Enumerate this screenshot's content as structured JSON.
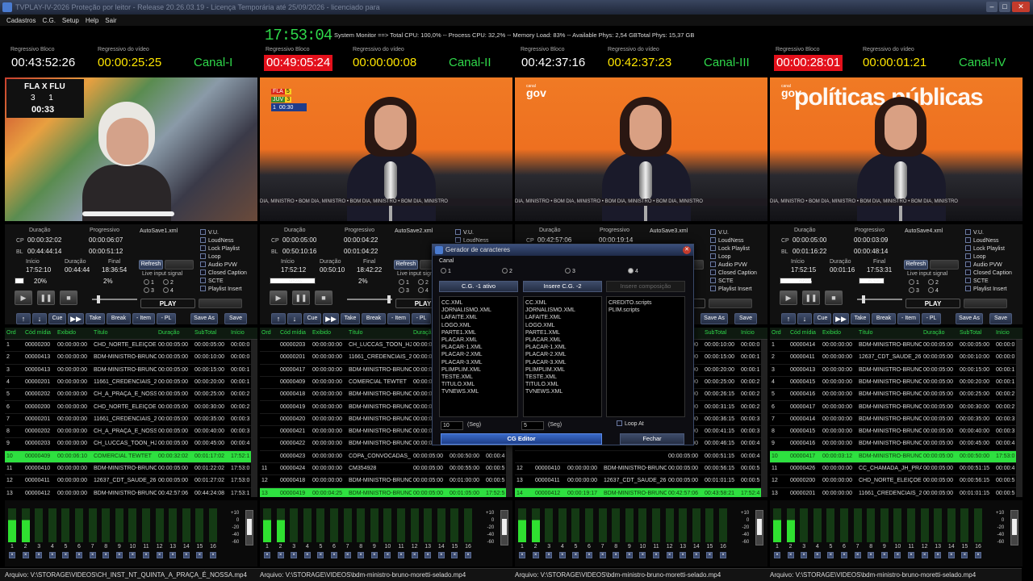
{
  "window": {
    "title": "TVPLAY-IV-2026 Proteção por leitor - Release 20.26.03.19 - Licença Temporária até 25/09/2026 - licenciado para"
  },
  "menu": [
    "Cadastros",
    "C.G.",
    "Setup",
    "Help",
    "Sair"
  ],
  "system": {
    "clock": "17:53:04",
    "monitor": "System Monitor ==> Total CPU: 100,0% -- Process CPU: 32,2% -- Memory Load: 83% -- Available Phys: 2,54 GBTotal  Phys: 15,37 GB"
  },
  "labels": {
    "regressivo_bloco": "Regressivo Bloco",
    "regressivo_video": "Regressivo do vídeo",
    "duracao": "Duração",
    "progressivo": "Progressivo",
    "cp": "CP",
    "bl": "BL",
    "inicio": "Início",
    "final": "Final",
    "refresh": "Refresh",
    "live_input": "Live input signal",
    "play": "PLAY",
    "grid_headers": [
      "Ord",
      "Cód mídia",
      "Exibido",
      "Título",
      "Duração",
      "SubTotal",
      "Início"
    ],
    "row_buttons": [
      "Cue",
      "Take",
      "Break",
      "- Item",
      "- PL",
      "Save As",
      "Save"
    ],
    "options": [
      "V.U.",
      "LoudNess",
      "Lock Playlist",
      "Loop",
      "Audio PVW",
      "Closed Caption",
      "SCTE",
      "Playlist Insert"
    ],
    "radio": [
      "1",
      "2",
      "3",
      "4"
    ],
    "db_scale": "+10\n  0\n-20\n-40\n-60",
    "meter_nums": [
      "1",
      "2",
      "3",
      "4",
      "5",
      "6",
      "7",
      "8",
      "9",
      "10",
      "11",
      "12",
      "13",
      "14",
      "15",
      "16"
    ]
  },
  "overlay": {
    "score_a": {
      "teams": "FLA X FLU",
      "score": "3      1",
      "time": "00:33"
    },
    "score_b": {
      "t1": "FLA",
      "t2": "JUV",
      "s1": "5",
      "s2": "3",
      "period": "1",
      "time": "00:30"
    },
    "gov": {
      "small": "canal",
      "big": "gov"
    },
    "politicas": "políticas públicas",
    "ticker": "DIA, MINISTRO • BOM DIA, MINISTRO • BOM DIA, MINISTRO • BOM DIA, MINISTRO"
  },
  "channels": [
    {
      "name": "Canal-I",
      "bloco": "00:43:52:26",
      "bloco_red": false,
      "video": "00:00:25:25",
      "cp_dur": "00:00:32:02",
      "cp_prog": "00:00:06:07",
      "bl_dur": "00:44:44:14",
      "bl_prog": "00:00:51:12",
      "autosave": "AutoSave1.xml",
      "inicio": "17:52:10",
      "duracao": "00:44:44",
      "final": "18:36:54",
      "pct1": "20%",
      "pct2": "2%",
      "progress1": 0.2,
      "progress2": 0.02,
      "rows": [
        [
          "1",
          "00000200",
          "00:00:00:00",
          "CHD_NORTE_ELEIÇÕES_",
          "00:00:05:00",
          "00:00:05:00",
          "00:00:0"
        ],
        [
          "2",
          "00000413",
          "00:00:00:00",
          "BDM-MINISTRO-BRUNO-I",
          "00:00:05:00",
          "00:00:10:00",
          "00:00:0"
        ],
        [
          "3",
          "00000413",
          "00:00:00:00",
          "BDM-MINISTRO-BRUNO-I",
          "00:00:05:00",
          "00:00:15:00",
          "00:00:1"
        ],
        [
          "4",
          "00000201",
          "00:00:00:00",
          "11661_CREDENCIAIS_26",
          "00:00:05:00",
          "00:00:20:00",
          "00:00:1"
        ],
        [
          "5",
          "00000202",
          "00:00:00:00",
          "CH_A_PRAÇA_É_NOSS",
          "00:00:05:00",
          "00:00:25:00",
          "00:00:2"
        ],
        [
          "6",
          "00000200",
          "00:00:00:00",
          "CHD_NORTE_ELEIÇÕES_",
          "00:00:05:00",
          "00:00:30:00",
          "00:00:2"
        ],
        [
          "7",
          "00000201",
          "00:00:00:00",
          "11661_CREDENCIAIS_26",
          "00:00:05:00",
          "00:00:35:00",
          "00:00:3"
        ],
        [
          "8",
          "00000202",
          "00:00:00:00",
          "CH_A_PRAÇA_É_NOSS",
          "00:00:05:00",
          "00:00:40:00",
          "00:00:3"
        ],
        [
          "9",
          "00000203",
          "00:00:00:00",
          "CH_LUCCAS_TOON_HJ_",
          "00:00:05:00",
          "00:00:45:00",
          "00:00:4"
        ],
        [
          "10",
          "00000409",
          "00:00:06:10",
          "COMERCIAL TEWTET",
          "00:00:32:02",
          "00:01:17:02",
          "17:52:1"
        ],
        [
          "11",
          "00000410",
          "00:00:00:00",
          "BDM-MINISTRO-BRUNO-I",
          "00:00:05:00",
          "00:01:22:02",
          "17:53:0"
        ],
        [
          "12",
          "00000411",
          "00:00:00:00",
          "12637_CDT_SAUDE_26",
          "00:00:05:00",
          "00:01:27:02",
          "17:53:0"
        ],
        [
          "13",
          "00000412",
          "00:00:00:00",
          "BDM-MINISTRO-BRUNO-I",
          "00:42:57:06",
          "00:44:24:08",
          "17:53:1"
        ]
      ],
      "hl_row": 9,
      "meter_on": [
        true,
        true
      ],
      "file": "Arquivo: V:\\STORAGE\\VIDEOS\\CH_INST_NT_QUINTA_A_PRAÇA_É_NOSSA.mp4"
    },
    {
      "name": "Canal-II",
      "bloco": "00:49:05:24",
      "bloco_red": true,
      "video": "00:00:00:08",
      "cp_dur": "00:00:05:00",
      "cp_prog": "00:00:04:22",
      "bl_dur": "00:50:10:16",
      "bl_prog": "00:01:04:22",
      "autosave": "AutoSave2.xml",
      "inicio": "17:52:12",
      "duracao": "00:50:10",
      "final": "18:42:22",
      "pct1": "95%",
      "pct2": "2%",
      "progress1": 0.95,
      "progress2": 0.02,
      "rows": [
        [
          "",
          "00000203",
          "00:00:00:00",
          "CH_LUCCAS_TOON_HJ_",
          "00:00:05:00",
          "00:00:05:00",
          "00:00:0"
        ],
        [
          "",
          "00000201",
          "00:00:00:00",
          "11661_CREDENCIAIS_26",
          "00:00:05:00",
          "00:00:10:00",
          "00:00:0"
        ],
        [
          "",
          "00000417",
          "00:00:00:00",
          "BDM-MINISTRO-BRUNO-I",
          "00:00:05:00",
          "00:00:15:00",
          "00:00:1"
        ],
        [
          "",
          "00000409",
          "00:00:00:00",
          "COMERCIAL TEWTET",
          "00:00:05:00",
          "00:00:20:00",
          "00:00:1"
        ],
        [
          "",
          "00000418",
          "00:00:00:00",
          "BDM-MINISTRO-BRUNO-I",
          "00:00:05:00",
          "00:00:25:00",
          "00:00:2"
        ],
        [
          "",
          "00000419",
          "00:00:00:00",
          "BDM-MINISTRO-BRUNO-I",
          "00:00:05:00",
          "00:00:30:00",
          "00:00:2"
        ],
        [
          "",
          "00000420",
          "00:00:00:00",
          "BDM-MINISTRO-BRUNO-I",
          "00:00:05:00",
          "00:00:35:00",
          "00:00:3"
        ],
        [
          "",
          "00000421",
          "00:00:00:00",
          "BDM-MINISTRO-BRUNO-I",
          "00:00:05:00",
          "00:00:40:00",
          "00:00:3"
        ],
        [
          "",
          "00000422",
          "00:00:00:00",
          "BDM-MINISTRO-BRUNO-I",
          "00:00:05:00",
          "00:00:45:00",
          "00:00:4"
        ],
        [
          "",
          "00000423",
          "00:00:00:00",
          "COPA_CONVOCADAS_",
          "00:00:05:00",
          "00:00:50:00",
          "00:00:4"
        ],
        [
          "11",
          "00000424",
          "00:00:00:00",
          "CM354928",
          "00:00:05:00",
          "00:00:55:00",
          "00:00:5"
        ],
        [
          "12",
          "00000418",
          "00:00:00:00",
          "BDM-MINISTRO-BRUNO-I",
          "00:00:05:00",
          "00:01:00:00",
          "00:00:5"
        ],
        [
          "13",
          "00000419",
          "00:00:04:25",
          "BDM-MINISTRO-BRUNO-I",
          "00:00:05:00",
          "00:01:05:00",
          "17:52:5"
        ],
        [
          "14",
          "00000420",
          "00:00:00:00",
          "BDM-MINISTRO-BRUNO-I",
          "00:00:05:00",
          "00:01:10:00",
          "17:53:0"
        ]
      ],
      "hl_row": 12,
      "meter_on": [
        true,
        true
      ],
      "file": "Arquivo: V:\\STORAGE\\VIDEOS\\bdm-ministro-bruno-moretti-selado.mp4"
    },
    {
      "name": "Canal-III",
      "bloco": "00:42:37:16",
      "bloco_red": false,
      "video": "00:42:37:23",
      "cp_dur": "00:42:57:06",
      "cp_prog": "00:00:19:14",
      "bl_dur": "",
      "bl_prog": "",
      "autosave": "AutoSave3.xml",
      "inicio": "",
      "duracao": "",
      "final": "",
      "pct1": "",
      "pct2": "",
      "progress1": 0,
      "progress2": 0,
      "rows": [
        [
          "",
          "",
          "",
          "",
          "00:00:05:00",
          "00:00:10:00",
          "00:00:0"
        ],
        [
          "",
          "",
          "",
          "",
          "00:00:05:00",
          "00:00:15:00",
          "00:00:1"
        ],
        [
          "",
          "",
          "",
          "",
          "00:00:05:00",
          "00:00:20:00",
          "00:00:1"
        ],
        [
          "",
          "",
          "",
          "",
          "00:00:05:00",
          "00:00:25:00",
          "00:00:2"
        ],
        [
          "",
          "",
          "",
          "",
          "00:00:05:00",
          "00:00:26:15",
          "00:00:2"
        ],
        [
          "",
          "",
          "",
          "",
          "00:00:05:00",
          "00:00:31:15",
          "00:00:2"
        ],
        [
          "",
          "",
          "",
          "",
          "00:00:05:00",
          "00:00:36:15",
          "00:00:3"
        ],
        [
          "",
          "",
          "",
          "",
          "00:00:05:00",
          "00:00:41:15",
          "00:00:3"
        ],
        [
          "",
          "",
          "",
          "",
          "00:00:05:00",
          "00:00:46:15",
          "00:00:4"
        ],
        [
          "",
          "",
          "",
          "",
          "00:00:05:00",
          "00:00:51:15",
          "00:00:4"
        ],
        [
          "12",
          "00000410",
          "00:00:00:00",
          "BDM-MINISTRO-BRUNO-I",
          "00:00:05:00",
          "00:00:56:15",
          "00:00:5"
        ],
        [
          "13",
          "00000411",
          "00:00:00:00",
          "12637_CDT_SAUDE_26",
          "00:00:05:00",
          "00:01:01:15",
          "00:00:5"
        ],
        [
          "14",
          "00000412",
          "00:00:19:17",
          "BDM-MINISTRO-BRUNO-I",
          "00:42:57:06",
          "00:43:58:21",
          "17:52:4"
        ]
      ],
      "hl_row": 12,
      "meter_on": [
        true,
        true
      ],
      "file": "Arquivo: V:\\STORAGE\\VIDEOS\\bdm-ministro-bruno-moretti-selado.mp4"
    },
    {
      "name": "Canal-IV",
      "bloco": "00:00:28:01",
      "bloco_red": true,
      "video": "00:00:01:21",
      "cp_dur": "00:00:05:00",
      "cp_prog": "00:00:03:09",
      "bl_dur": "00:01:16:22",
      "bl_prog": "00:00:48:14",
      "autosave": "AutoSave4.xml",
      "inicio": "17:52:15",
      "duracao": "00:01:16",
      "final": "17:53:31",
      "pct1": "66%",
      "pct2": "63%",
      "progress1": 0.66,
      "progress2": 0.63,
      "rows": [
        [
          "1",
          "00000414",
          "00:00:00:00",
          "BDM-MINISTRO-BRUNO-I",
          "00:00:05:00",
          "00:00:05:00",
          "00:00:0"
        ],
        [
          "2",
          "00000411",
          "00:00:00:00",
          "12637_CDT_SAUDE_26",
          "00:00:05:00",
          "00:00:10:00",
          "00:00:0"
        ],
        [
          "3",
          "00000413",
          "00:00:00:00",
          "BDM-MINISTRO-BRUNO-I",
          "00:00:05:00",
          "00:00:15:00",
          "00:00:1"
        ],
        [
          "4",
          "00000415",
          "00:00:00:00",
          "BDM-MINISTRO-BRUNO-I",
          "00:00:05:00",
          "00:00:20:00",
          "00:00:1"
        ],
        [
          "5",
          "00000416",
          "00:00:00:00",
          "BDM-MINISTRO-BRUNO-I",
          "00:00:05:00",
          "00:00:25:00",
          "00:00:2"
        ],
        [
          "6",
          "00000417",
          "00:00:00:00",
          "BDM-MINISTRO-BRUNO-I",
          "00:00:05:00",
          "00:00:30:00",
          "00:00:2"
        ],
        [
          "7",
          "00000414",
          "00:00:00:00",
          "BDM-MINISTRO-BRUNO-I",
          "00:00:05:00",
          "00:00:35:00",
          "00:00:3"
        ],
        [
          "8",
          "00000415",
          "00:00:00:00",
          "BDM-MINISTRO-BRUNO-I",
          "00:00:05:00",
          "00:00:40:00",
          "00:00:3"
        ],
        [
          "9",
          "00000416",
          "00:00:00:00",
          "BDM-MINISTRO-BRUNO-I",
          "00:00:05:00",
          "00:00:45:00",
          "00:00:4"
        ],
        [
          "10",
          "00000417",
          "00:00:03:12",
          "BDM-MINISTRO-BRUNO-I",
          "00:00:05:00",
          "00:00:50:00",
          "17:53:0"
        ],
        [
          "11",
          "00000426",
          "00:00:00:00",
          "CC_CHAMADA_JH_PRA",
          "00:00:05:00",
          "00:00:51:15",
          "00:00:4"
        ],
        [
          "12",
          "00000200",
          "00:00:00:00",
          "CHD_NORTE_ELEIÇÕES_",
          "00:00:05:00",
          "00:00:56:15",
          "00:00:5"
        ],
        [
          "13",
          "00000201",
          "00:00:00:00",
          "11661_CREDENCIAIS_26",
          "00:00:05:00",
          "00:01:01:15",
          "00:00:5"
        ]
      ],
      "hl_row": 9,
      "meter_on": [
        true,
        true
      ],
      "file": "Arquivo: V:\\STORAGE\\VIDEOS\\bdm-ministro-bruno-moretti-selado.mp4"
    }
  ],
  "dialog": {
    "title": "Gerador de caracteres",
    "canal_label": "Canal",
    "radios": [
      "1",
      "2",
      "3",
      "4"
    ],
    "btn1": "C.G. -1 ativo",
    "btn2": "Insere C.G. -2",
    "btn3": "Insere composição",
    "list1": "CC.XML\nJORNALISMO.XML\nLAFAITE.XML\nLOGO.XML\nPARTE1.XML\nPLACAR.XML\nPLACAR-1.XML\nPLACAR-2.XML\nPLACAR-3.XML\nPLIMPLIM.XML\nTESTE.XML\nTITULO.XML\nTVNEWS.XML",
    "list2": "CC.XML\nJORNALISMO.XML\nLAFAITE.XML\nLOGO.XML\nPARTE1.XML\nPLACAR.XML\nPLACAR-1.XML\nPLACAR-2.XML\nPLACAR-3.XML\nPLIMPLIM.XML\nTESTE.XML\nTITULO.XML\nTVNEWS.XML",
    "list3": "CREDITO.scripts\nPLIM.scripts",
    "sec1": "10",
    "sec2": "5",
    "seg": "(Seg)",
    "loop": "Loop At",
    "editor": "CG Editor",
    "close": "Fechar"
  }
}
